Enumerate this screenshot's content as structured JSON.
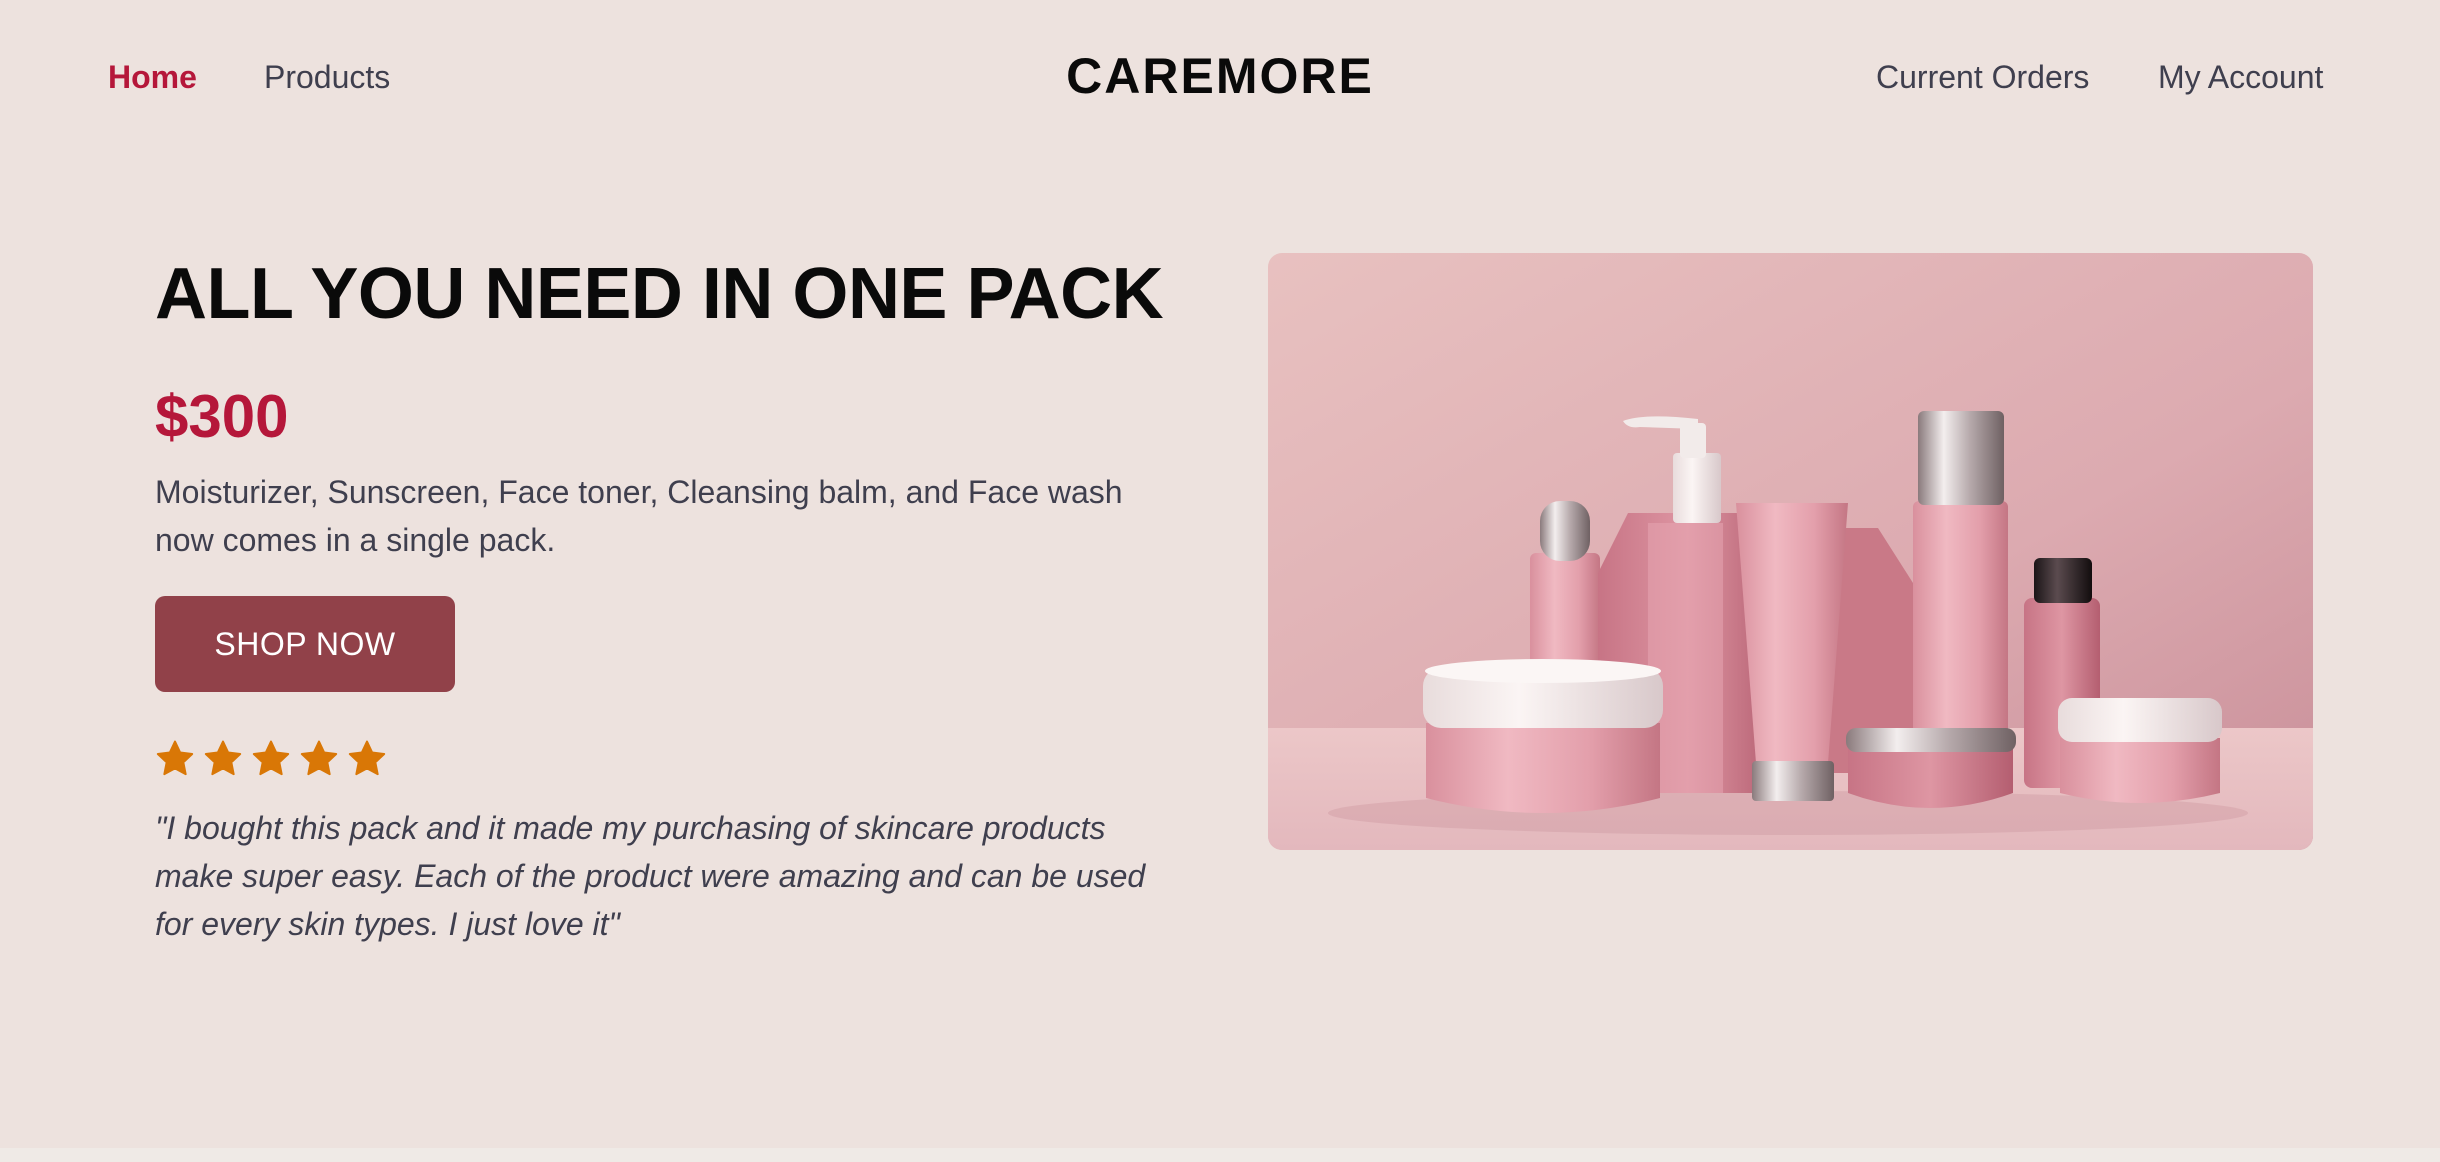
{
  "nav": {
    "links": [
      {
        "label": "Home",
        "active": true
      },
      {
        "label": "Products",
        "active": false
      }
    ],
    "brand": "CAREMORE",
    "right_links": [
      {
        "label": "Current Orders"
      },
      {
        "label": "My Account"
      }
    ]
  },
  "hero": {
    "title": "ALL YOU NEED IN ONE PACK",
    "price": "$300",
    "description": "Moisturizer, Sunscreen, Face toner, Cleansing balm, and Face wash now comes in a single pack.",
    "cta_label": "SHOP NOW",
    "rating": 5,
    "rating_max": 5,
    "review": "\"I bought this pack and it made my purchasing of skincare products make super easy. Each of the product were amazing and can be used for every skin types. I just love it\"",
    "image": "product-pack-photo"
  },
  "colors": {
    "background": "#ede2de",
    "accent": "#b5173a",
    "button": "#914149",
    "star": "#d97706",
    "text": "#3f3f4e"
  },
  "icons": {
    "star": "star-icon"
  }
}
